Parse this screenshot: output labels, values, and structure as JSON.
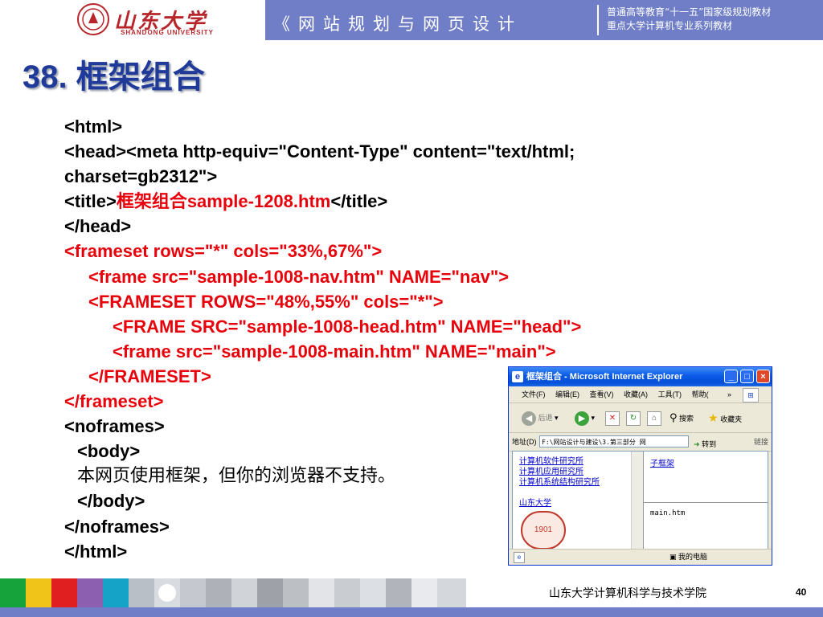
{
  "header": {
    "logo_text": "山东大学",
    "logo_sub": "SHANDONG UNIVERSITY",
    "course_title": "《网站规划与网页设计",
    "series_line1": "普通高等教育“十一五”国家级规划教材",
    "series_line2": "重点大学计算机专业系列教材"
  },
  "title": "38. 框架组合",
  "code": {
    "l1": "<html>",
    "l2": "<head><meta http-equiv=\"Content-Type\" content=\"text/html;",
    "l3": "charset=gb2312\">",
    "l4_a": "<title>",
    "l4_red": "框架组合sample-1208.htm",
    "l4_b": "</title>",
    "l5": "</head>",
    "l6": "<frameset rows=\"*\" cols=\"33%,67%\">",
    "l7": "<frame src=\"sample-1008-nav.htm\" NAME=\"nav\">",
    "l8": "<FRAMESET ROWS=\"48%,55%\" cols=\"*\">",
    "l9": "<FRAME SRC=\"sample-1008-head.htm\" NAME=\"head\">",
    "l10": "<frame src=\"sample-1008-main.htm\" NAME=\"main\">",
    "l11": "</FRAMESET>",
    "l12": "</frameset>",
    "l13": "<noframes>",
    "l14": "<body>",
    "l15": "本网页使用框架，但你的浏览器不支持。",
    "l16": "</body>",
    "l17": "</noframes>",
    "l18": "</html>"
  },
  "browser": {
    "window_title": "框架组合 - Microsoft Internet Explorer",
    "menu": [
      "文件(F)",
      "编辑(E)",
      "查看(V)",
      "收藏(A)",
      "工具(T)",
      "帮助("
    ],
    "menu_more": "»",
    "back_label": "后退",
    "search_label": "搜索",
    "favorites_label": "收藏夹",
    "address_label": "地址(D)",
    "address_value": "F:\\网站设计与建设\\3.第三部分 网",
    "go_label": "转到",
    "links_label": "链接",
    "nav_links": [
      "计算机软件研究所",
      "计算机应用研究所",
      "计算机系统结构研究所"
    ],
    "nav_link_sdu": "山东大学",
    "seal_text": "1901",
    "head_link": "子框架",
    "main_text": "main.htm",
    "status_zone": "我的电脑"
  },
  "footer": {
    "school": "山东大学计算机科学与技术学院",
    "page": "40"
  },
  "colors": {
    "header_bg": "#6f7ec6",
    "title": "#1f3a99",
    "code_red": "#e8000a"
  }
}
